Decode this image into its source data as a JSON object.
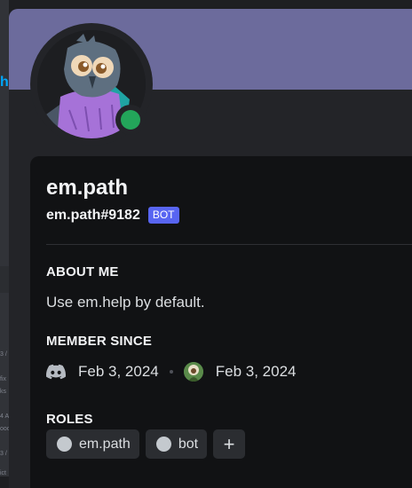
{
  "background": {
    "accent_fragment": "h",
    "fragments": [
      "3 /",
      "fix",
      "ks",
      "4 A",
      "ooo",
      "3 /",
      "ict"
    ]
  },
  "profile": {
    "display_name": "em.path",
    "tag": "em.path#9182",
    "badge": "BOT",
    "status": "online",
    "status_color": "#23a55a",
    "banner_color": "#6c6b9c"
  },
  "about": {
    "heading": "ABOUT ME",
    "text": "Use em.help by default."
  },
  "member_since": {
    "heading": "MEMBER SINCE",
    "discord_icon": "discord-logo-icon",
    "discord_date": "Feb 3, 2024",
    "server_icon": "server-avatar-icon",
    "server_date": "Feb 3, 2024"
  },
  "roles": {
    "heading": "ROLES",
    "items": [
      {
        "label": "em.path",
        "color": "#c4c9ce"
      },
      {
        "label": "bot",
        "color": "#c4c9ce"
      }
    ],
    "add_label": "+"
  }
}
